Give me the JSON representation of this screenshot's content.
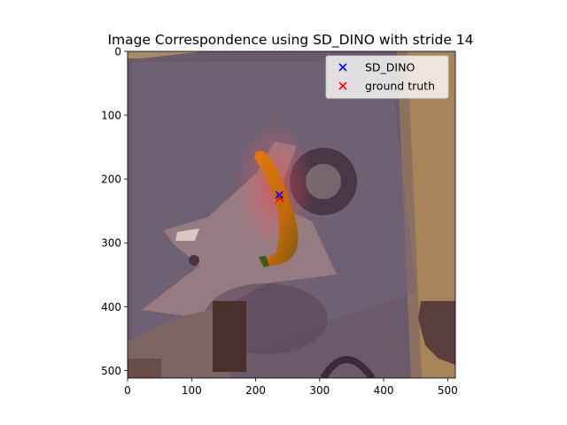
{
  "chart_data": {
    "type": "scatter",
    "title": "Image Correspondence using SD_DINO with  stride 14",
    "xlabel": "",
    "ylabel": "",
    "xlim": [
      0,
      512
    ],
    "ylim": [
      512,
      0
    ],
    "y_inverted": true,
    "x_ticks": [
      0,
      100,
      200,
      300,
      400,
      500
    ],
    "y_ticks": [
      0,
      100,
      200,
      300,
      400,
      500
    ],
    "background": "image heatmap overlay (photo of a banana on a patterned mat)",
    "grid": false,
    "legend_position": "top-right",
    "series": [
      {
        "name": "SD_DINO",
        "marker": "x",
        "color": "#0000ff",
        "points": [
          [
            237,
            225
          ]
        ]
      },
      {
        "name": "ground truth",
        "marker": "x",
        "color": "#ff0000",
        "points": [
          [
            238,
            230
          ]
        ]
      }
    ]
  }
}
